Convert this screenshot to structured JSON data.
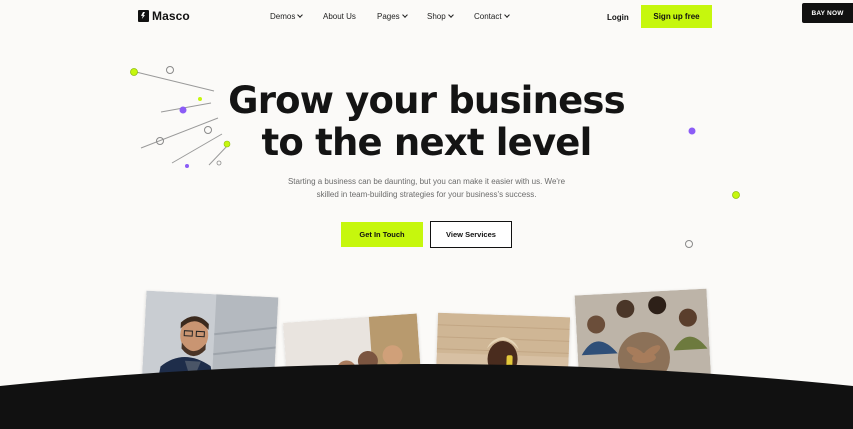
{
  "brand": {
    "name": "Masco",
    "logo_icon": "lightning-bolt-icon"
  },
  "nav": {
    "items": [
      {
        "label": "Demos",
        "has_dropdown": true
      },
      {
        "label": "About Us",
        "has_dropdown": false
      },
      {
        "label": "Pages",
        "has_dropdown": true
      },
      {
        "label": "Shop",
        "has_dropdown": true
      },
      {
        "label": "Contact",
        "has_dropdown": true
      }
    ],
    "login_label": "Login",
    "signup_label": "Sign up free",
    "buy_now_label": "BAY NOW"
  },
  "hero": {
    "title_line1": "Grow your business",
    "title_line2": "to the next level",
    "subtitle_line1": "Starting a business can be daunting, but you can make it easier with us. We're",
    "subtitle_line2": "skilled in team-building strategies for your business's success.",
    "primary_cta": "Get In Touch",
    "secondary_cta": "View Services"
  },
  "colors": {
    "accent": "#c6f70d",
    "accent_dot": "#a6e31a",
    "purple_dot": "#8b5cf6",
    "background": "#fbfaf8",
    "dark": "#111111"
  },
  "photos": [
    {
      "subject": "man-with-laptop"
    },
    {
      "subject": "team-at-desk"
    },
    {
      "subject": "man-on-phone"
    },
    {
      "subject": "team-hands-together"
    }
  ]
}
